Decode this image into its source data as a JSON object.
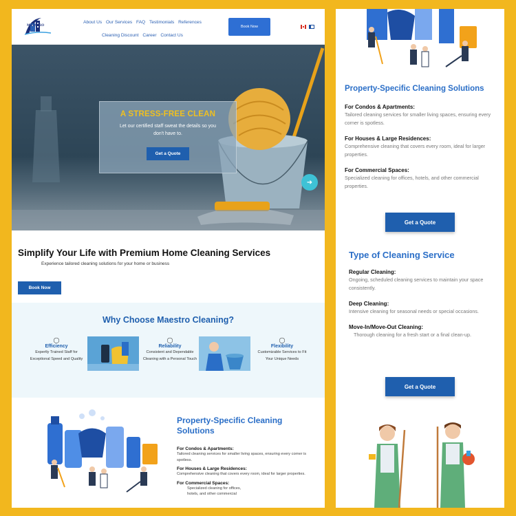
{
  "desktop": {
    "logo": {
      "text": "MAESTRO"
    },
    "nav": {
      "items": [
        "About Us",
        "Our Services",
        "FAQ",
        "Testimonials",
        "References",
        "Cleaning Discount",
        "Career",
        "Contact Us"
      ],
      "book_label": "Book Now",
      "flags": [
        "canada-flag-icon",
        "france-flag-icon"
      ]
    },
    "hero": {
      "title": "A STRESS-FREE CLEAN",
      "subtitle": "Let our certified staff sweat the details so you don't have to.",
      "button": "Get a Quote"
    },
    "intro": {
      "heading": "Simplify Your Life with Premium Home Cleaning Services",
      "subheading": "Experience tailored cleaning solutions for your home or business",
      "button": "Book Now"
    },
    "why": {
      "heading": "Why Choose Maestro Cleaning?",
      "items": [
        {
          "title": "Efficiency",
          "desc": "Expertly Trained Staff for Exceptional Speed and Quality"
        },
        {
          "title": "Reliability",
          "desc": "Consistent and Dependable Cleaning with a Personal Touch"
        },
        {
          "title": "Flexibility",
          "desc": "Customizable Services to Fit Your Unique Needs"
        }
      ]
    },
    "property": {
      "heading": "Property-Specific Cleaning Solutions",
      "items": [
        {
          "title": "For Condos & Apartments:",
          "desc": "Tailored cleaning services for smaller living spaces, ensuring every corner is spotless."
        },
        {
          "title": "For Houses & Large Residences:",
          "desc": "Comprehensive cleaning that covers every room, ideal for larger properties."
        },
        {
          "title": "For Commercial Spaces:",
          "desc": "Specialized cleaning for offices, hotels, and other commercial"
        }
      ]
    }
  },
  "mobile": {
    "property": {
      "heading": "Property-Specific Cleaning Solutions",
      "items": [
        {
          "title": "For Condos & Apartments:",
          "desc": "Tailored cleaning services for smaller living spaces, ensuring every corner is spotless."
        },
        {
          "title": "For Houses & Large Residences:",
          "desc": "Comprehensive cleaning that covers every room, ideal for larger properties."
        },
        {
          "title": "For Commercial Spaces:",
          "desc": "Specialized cleaning for offices, hotels, and other commercial properties."
        }
      ],
      "button": "Get a Quote"
    },
    "types": {
      "heading": "Type of Cleaning Service",
      "items": [
        {
          "title": "Regular Cleaning:",
          "desc": "Ongoing, scheduled cleaning services to maintain your space consistently."
        },
        {
          "title": "Deep Cleaning:",
          "desc": "Intensive cleaning for seasonal needs or special occasions."
        },
        {
          "title": "Move-In/Move-Out Cleaning:",
          "desc": "Thorough cleaning for a fresh start or a final clean-up."
        }
      ],
      "button": "Get a Quote"
    }
  },
  "colors": {
    "frame": "#f2b71e",
    "primary": "#1f5fae",
    "accent": "#2a6ec7",
    "hero_title": "#f0c020"
  }
}
